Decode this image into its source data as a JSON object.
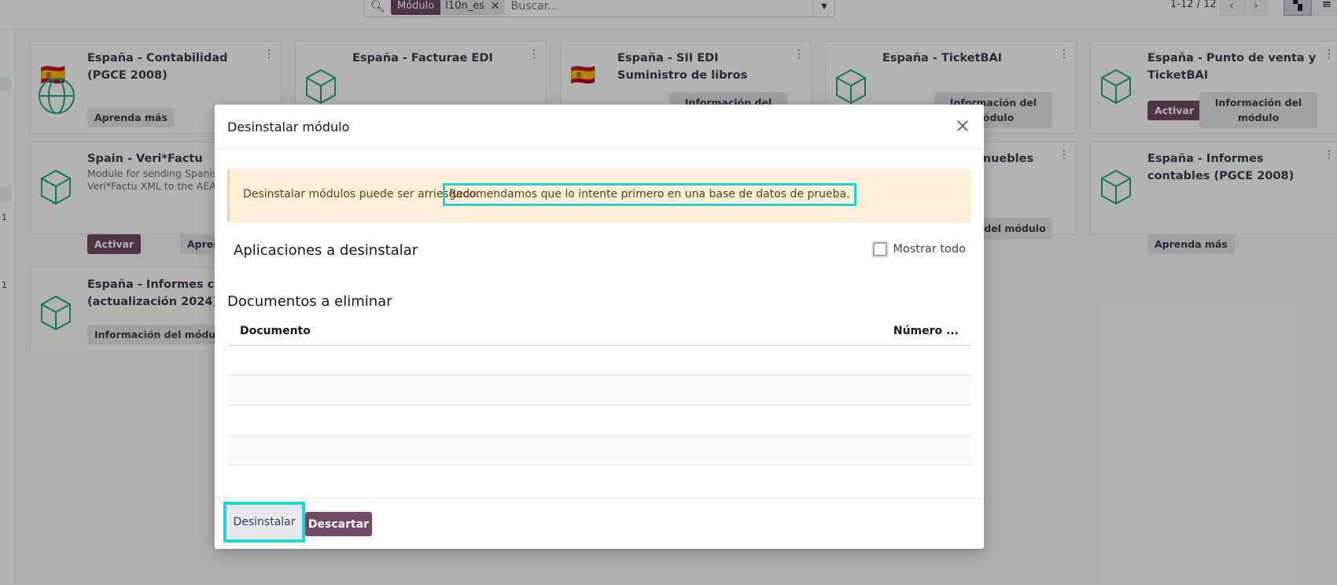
{
  "search": {
    "facet_label": "Módulo",
    "facet_value": "l10n_es",
    "placeholder": "Buscar..."
  },
  "pager": {
    "value": "1-12 / 12"
  },
  "left_strip": {
    "counts": [
      "1",
      "1"
    ]
  },
  "cards": [
    {
      "title": "España - Contabilidad (PGCE 2008)",
      "btn_learn": "Aprenda más"
    },
    {
      "title": "España - Facturae EDI"
    },
    {
      "title": "España - SII EDI Suministro de libros",
      "btn_info": "Información del"
    },
    {
      "title": "España - TicketBAI",
      "btn_info": "Información del módulo"
    },
    {
      "title": "España - Punto de venta y TicketBAI",
      "btn_activate": "Activar",
      "btn_info": "Información del módulo"
    },
    {
      "title": "Spain - Veri*Factu",
      "desc": "Module for sending Spanish Veri*Factu XML to the AEAT",
      "btn_activate": "Activar",
      "btn_learn": "Apren"
    },
    {
      "title": "muebles",
      "btn_info": "mación del módulo"
    },
    {
      "title": "España - Informes contables (PGCE 2008)",
      "btn_learn": "Aprenda más"
    },
    {
      "title": "España - Informes cont (actualización 2024)",
      "btn_info": "Información del módulo"
    }
  ],
  "modal": {
    "title": "Desinstalar módulo",
    "alert_text": "Desinstalar módulos puede ser arriesgado.",
    "alert_highlight": "Recomendamos que lo intente primero en una base de datos de prueba.",
    "apps_title": "Aplicaciones a desinstalar",
    "show_all": "Mostrar todo",
    "docs_title": "Documentos a eliminar",
    "col_document": "Documento",
    "col_number": "Número ...",
    "btn_uninstall": "Desinstalar",
    "btn_discard": "Descartar"
  },
  "colors": {
    "brand": "#714b67",
    "highlight": "#22d3d8",
    "alert_bg": "#fcefd9",
    "icon_green": "#22a88a"
  }
}
